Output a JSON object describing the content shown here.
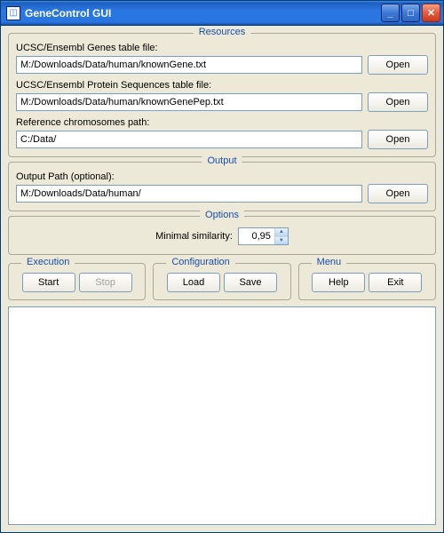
{
  "window": {
    "title": "GeneControl GUI"
  },
  "resources": {
    "legend": "Resources",
    "genes": {
      "label": "UCSC/Ensembl Genes table file:",
      "value": "M:/Downloads/Data/human/knownGene.txt",
      "open": "Open"
    },
    "proteins": {
      "label": "UCSC/Ensembl Protein Sequences table file:",
      "value": "M:/Downloads/Data/human/knownGenePep.txt",
      "open": "Open"
    },
    "chromosomes": {
      "label": "Reference chromosomes path:",
      "value": "C:/Data/",
      "open": "Open"
    }
  },
  "output": {
    "legend": "Output",
    "path": {
      "label": "Output Path (optional):",
      "value": "M:/Downloads/Data/human/",
      "open": "Open"
    }
  },
  "options": {
    "legend": "Options",
    "minsim": {
      "label": "Minimal similarity:",
      "value": "0,95"
    }
  },
  "execution": {
    "legend": "Execution",
    "start": "Start",
    "stop": "Stop"
  },
  "configuration": {
    "legend": "Configuration",
    "load": "Load",
    "save": "Save"
  },
  "menu": {
    "legend": "Menu",
    "help": "Help",
    "exit": "Exit"
  }
}
